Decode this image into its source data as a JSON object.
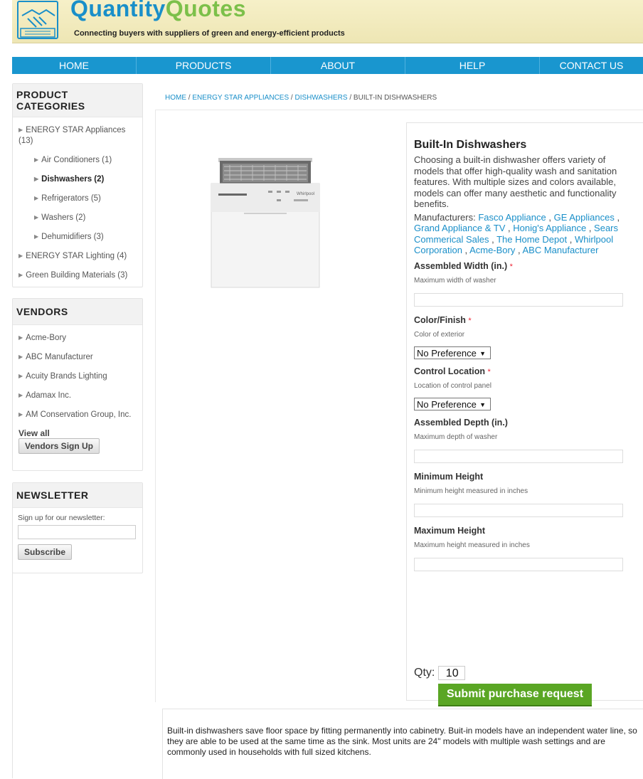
{
  "header": {
    "brand_part1": "Quantity",
    "brand_part2": "Quotes",
    "tagline": "Connecting buyers with suppliers of green and energy-efficient products",
    "logo_icon": "handshake-icon"
  },
  "nav": {
    "items": [
      {
        "label": "HOME"
      },
      {
        "label": "PRODUCTS"
      },
      {
        "label": "ABOUT"
      },
      {
        "label": "HELP"
      },
      {
        "label": "CONTACT US"
      }
    ]
  },
  "sidebar": {
    "categories": {
      "title": "PRODUCT CATEGORIES",
      "items": [
        {
          "label": "ENERGY STAR Appliances (13)"
        },
        {
          "label": "Air Conditioners (1)"
        },
        {
          "label": "Dishwashers (2)"
        },
        {
          "label": "Refrigerators (5)"
        },
        {
          "label": "Washers (2)"
        },
        {
          "label": "Dehumidifiers (3)"
        },
        {
          "label": "ENERGY STAR Lighting (4)"
        },
        {
          "label": "Green Building Materials (3)"
        }
      ]
    },
    "vendors": {
      "title": "VENDORS",
      "items": [
        {
          "label": "Acme-Bory"
        },
        {
          "label": "ABC Manufacturer"
        },
        {
          "label": "Acuity Brands Lighting"
        },
        {
          "label": "Adamax Inc."
        },
        {
          "label": "AM Conservation Group, Inc."
        }
      ],
      "view_all": "View all",
      "signup_button": "Vendors Sign Up"
    },
    "newsletter": {
      "title": "NEWSLETTER",
      "prompt": "Sign up for our newsletter:",
      "email_value": "",
      "subscribe_button": "Subscribe"
    }
  },
  "breadcrumb": {
    "home": "HOME",
    "sep": " / ",
    "level1": "ENERGY STAR APPLIANCES",
    "level2": "DISHWASHERS",
    "current": "BUILT-IN DISHWASHERS"
  },
  "product": {
    "title": "Built-In Dishwashers",
    "description": "Choosing a built-in dishwasher offers variety of models that offer high-quality wash and sanitation features. With multiple sizes and colors available, models can offer many aesthetic and functionality benefits.",
    "manufacturers_label": "Manufacturers:",
    "manufacturers": [
      "Fasco Appliance",
      "GE Appliances",
      "Grand Appliance & TV",
      "Honig's Appliance",
      "Sears Commerical Sales",
      "The Home Depot",
      "Whirlpool Corporation",
      "Acme-Bory",
      "ABC Manufacturer"
    ],
    "fields": {
      "width": {
        "label": "Assembled Width (in.)",
        "required": "*",
        "help": "Maximum width of washer",
        "value": ""
      },
      "color": {
        "label": "Color/Finish",
        "required": "*",
        "help": "Color of exterior",
        "selected": "No Preference"
      },
      "control": {
        "label": "Control Location",
        "required": "*",
        "help": "Location of control panel",
        "selected": "No Preference"
      },
      "depth": {
        "label": "Assembled Depth (in.)",
        "help": "Maximum depth of washer",
        "value": ""
      },
      "min_height": {
        "label": "Minimum Height",
        "help": "Minimum height measured in inches",
        "value": ""
      },
      "max_height": {
        "label": "Maximum Height",
        "help": "Maximum height measured in inches",
        "value": ""
      }
    },
    "qty_label": "Qty:",
    "qty_value": "10",
    "submit_label": "Submit purchase request"
  },
  "bottom": {
    "description": "Built-in dishwashers save floor space by fitting permanently into cabinetry. Buit-in models have an independent water line, so they are able to be used at the same time as the sink. Most units are 24\" models with multiple wash settings and are commonly used in households with full sized kitchens."
  },
  "colors": {
    "nav_blue": "#1996cf",
    "link_blue": "#1a8fc9",
    "brand_green": "#7cc04a",
    "submit_green": "#5aa624"
  }
}
